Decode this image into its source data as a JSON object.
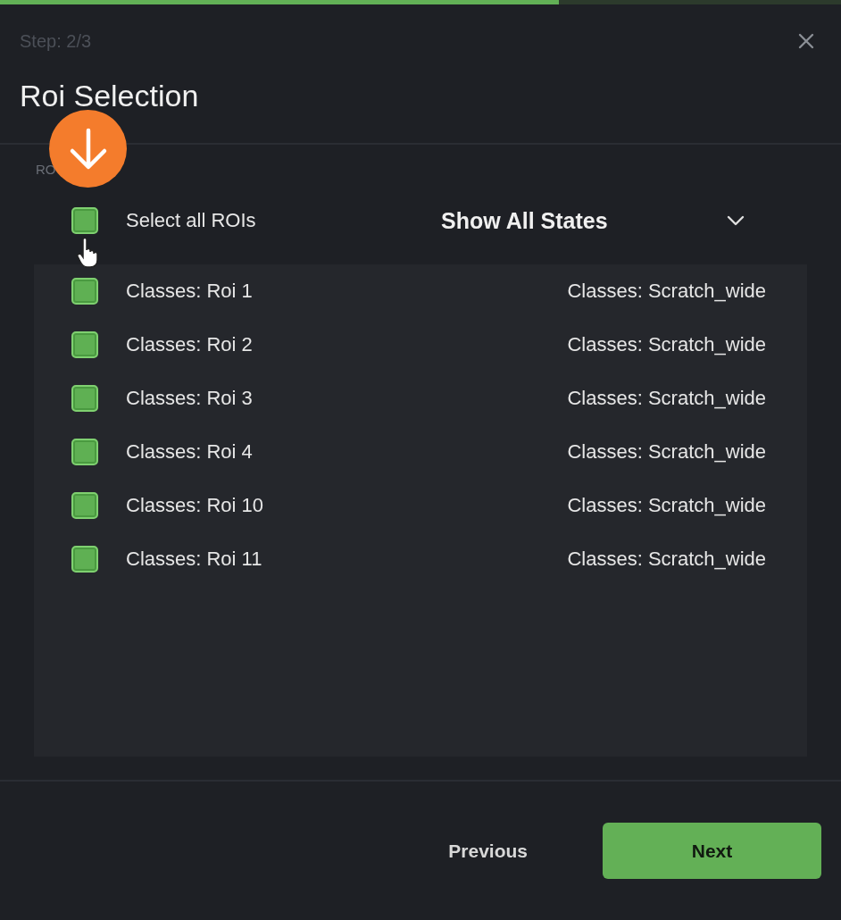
{
  "progress": {
    "level": 0.665
  },
  "header": {
    "step": "Step: 2/3",
    "title": "Roi Selection"
  },
  "section_label": "RO",
  "select_all": {
    "label": "Select all ROIs",
    "checked": true
  },
  "state_filter": {
    "value": "Show All States"
  },
  "rois": [
    {
      "name": "Classes: Roi 1",
      "class": "Classes: Scratch_wide",
      "checked": true
    },
    {
      "name": "Classes: Roi 2",
      "class": "Classes: Scratch_wide",
      "checked": true
    },
    {
      "name": "Classes: Roi 3",
      "class": "Classes: Scratch_wide",
      "checked": true
    },
    {
      "name": "Classes: Roi 4",
      "class": "Classes: Scratch_wide",
      "checked": true
    },
    {
      "name": "Classes: Roi 10",
      "class": "Classes: Scratch_wide",
      "checked": true
    },
    {
      "name": "Classes: Roi 11",
      "class": "Classes: Scratch_wide",
      "checked": true
    }
  ],
  "footer": {
    "previous": "Previous",
    "next": "Next"
  }
}
